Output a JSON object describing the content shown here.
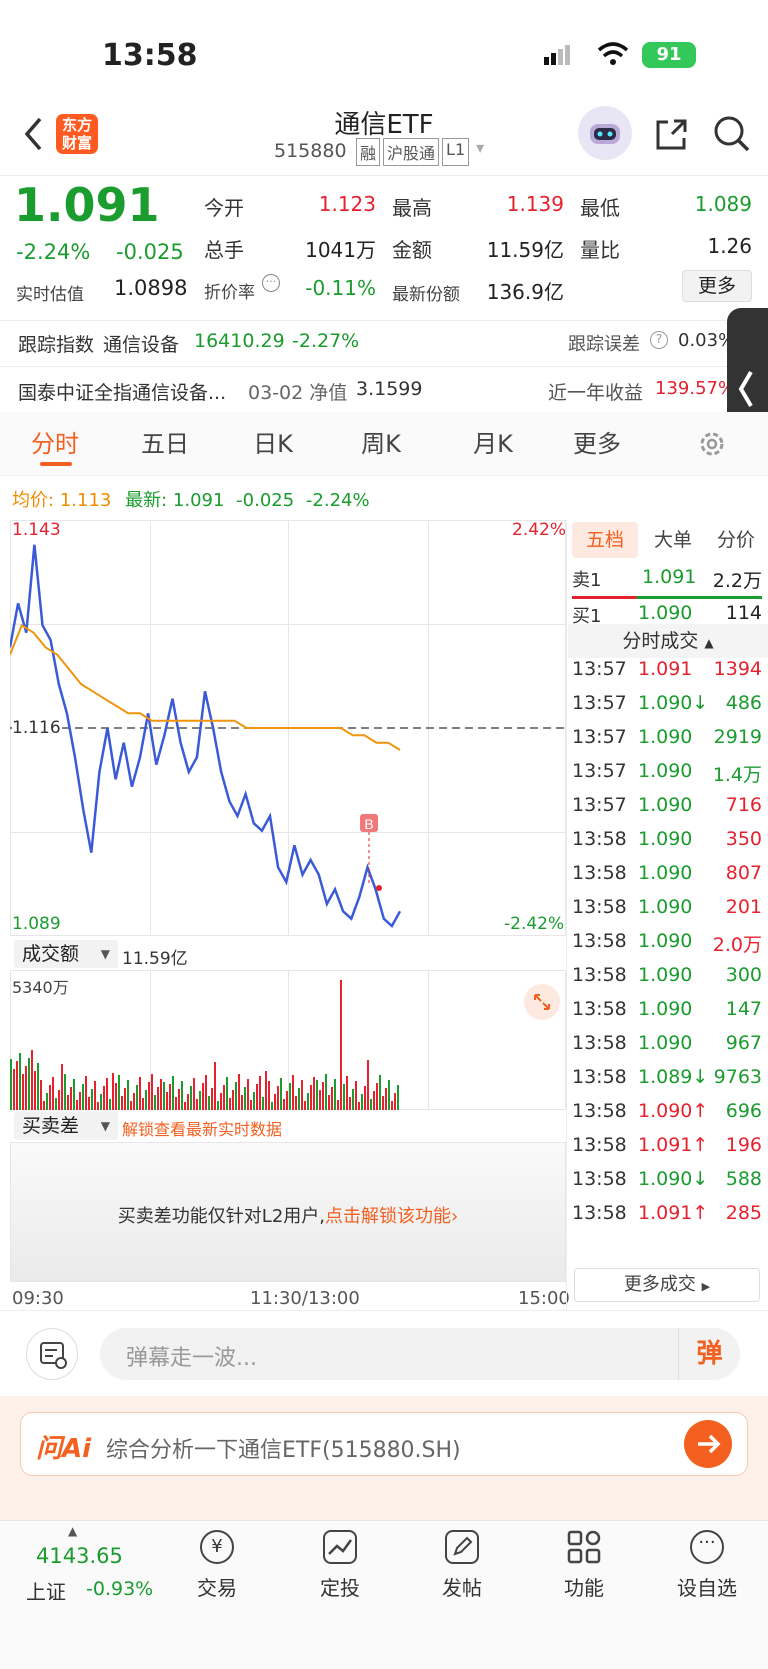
{
  "status": {
    "time": "13:58",
    "battery": "91"
  },
  "header": {
    "logo": "东方\n财富",
    "title": "通信ETF",
    "code": "515880",
    "tags": [
      "融",
      "沪股通",
      "L1"
    ]
  },
  "quote": {
    "price": "1.091",
    "change_pct": "-2.24%",
    "change": "-0.025",
    "est_label": "实时估值",
    "est": "1.0898",
    "open_label": "今开",
    "open": "1.123",
    "high_label": "最高",
    "high": "1.139",
    "low_label": "最低",
    "low": "1.089",
    "vol_label": "总手",
    "vol": "1041万",
    "amount_label": "金额",
    "amount": "11.59亿",
    "ratio_label": "量比",
    "ratio": "1.26",
    "disc_label": "折价率",
    "disc": "-0.11%",
    "shares_label": "最新份额",
    "shares": "136.9亿",
    "more": "更多"
  },
  "tracking": {
    "label": "跟踪指数",
    "index": "通信设备",
    "value": "16410.29",
    "pct": "-2.27%",
    "err_label": "跟踪误差",
    "err": "0.03%"
  },
  "fund": {
    "name": "国泰中证全指通信设备...",
    "date": "03-02 净值",
    "nav": "3.1599",
    "ret_label": "近一年收益",
    "ret": "139.57%"
  },
  "tabs": [
    "分时",
    "五日",
    "日K",
    "周K",
    "月K",
    "更多"
  ],
  "avgline": {
    "avg_label": "均价:",
    "avg": "1.113",
    "latest_label": "最新:",
    "latest": "1.091",
    "chg": "-0.025",
    "pct": "-2.24%"
  },
  "chart_data": {
    "type": "line",
    "ylim": [
      1.089,
      1.143
    ],
    "ref": "1.116",
    "y_top": "1.143",
    "y_bottom": "1.089",
    "pct_top": "2.42%",
    "pct_bottom": "-2.42%",
    "x_labels": [
      "09:30",
      "11:30/13:00",
      "15:00"
    ],
    "series": [
      {
        "values": [
          1.127,
          1.133,
          1.129,
          1.141,
          1.13,
          1.128,
          1.122,
          1.118,
          1.112,
          1.105,
          1.099,
          1.11,
          1.116,
          1.109,
          1.114,
          1.108,
          1.112,
          1.118,
          1.111,
          1.115,
          1.12,
          1.114,
          1.11,
          1.112,
          1.121,
          1.116,
          1.11,
          1.106,
          1.104,
          1.107,
          1.103,
          1.102,
          1.104,
          1.097,
          1.095,
          1.1,
          1.096,
          1.098,
          1.096,
          1.092,
          1.094,
          1.091,
          1.09,
          1.093,
          1.097,
          1.094,
          1.09,
          1.089,
          1.091
        ]
      },
      {
        "values": [
          1.126,
          1.13,
          1.129,
          1.127,
          1.126,
          1.124,
          1.122,
          1.121,
          1.12,
          1.119,
          1.118,
          1.118,
          1.117,
          1.117,
          1.117,
          1.117,
          1.117,
          1.117,
          1.117,
          1.117,
          1.116,
          1.116,
          1.116,
          1.116,
          1.116,
          1.116,
          1.116,
          1.116,
          1.116,
          1.115,
          1.115,
          1.114,
          1.114,
          1.113
        ]
      }
    ]
  },
  "vol": {
    "label": "成交额",
    "amount": "11.59亿",
    "max": "5340万"
  },
  "bsd": {
    "label": "买卖差",
    "unlock": "解锁查看最新实时数据",
    "notice": "买卖差功能仅针对L2用户,",
    "notice_link": "点击解锁该功能"
  },
  "book": {
    "tabs": [
      "五档",
      "大单",
      "分价"
    ],
    "sell_label": "卖1",
    "sell_price": "1.091",
    "sell_vol": "2.2万",
    "buy_label": "买1",
    "buy_price": "1.090",
    "buy_vol": "114",
    "ticks_label": "分时成交",
    "more": "更多成交"
  },
  "trades": [
    [
      "13:57",
      "1.091",
      "1394",
      "r"
    ],
    [
      "13:57",
      "1.090↓",
      "486",
      "g"
    ],
    [
      "13:57",
      "1.090",
      "2919",
      "g"
    ],
    [
      "13:57",
      "1.090",
      "1.4万",
      "g"
    ],
    [
      "13:57",
      "1.090",
      "716",
      "r"
    ],
    [
      "13:58",
      "1.090",
      "350",
      "r"
    ],
    [
      "13:58",
      "1.090",
      "807",
      "r"
    ],
    [
      "13:58",
      "1.090",
      "201",
      "r"
    ],
    [
      "13:58",
      "1.090",
      "2.0万",
      "r"
    ],
    [
      "13:58",
      "1.090",
      "300",
      "g"
    ],
    [
      "13:58",
      "1.090",
      "147",
      "g"
    ],
    [
      "13:58",
      "1.090",
      "967",
      "g"
    ],
    [
      "13:58",
      "1.089↓",
      "9763",
      "g"
    ],
    [
      "13:58",
      "1.090↑",
      "696",
      "g"
    ],
    [
      "13:58",
      "1.091↑",
      "196",
      "r"
    ],
    [
      "13:58",
      "1.090↓",
      "588",
      "g"
    ],
    [
      "13:58",
      "1.091↑",
      "285",
      "r"
    ]
  ],
  "danmu": {
    "placeholder": "弹幕走一波...",
    "btn": "弹"
  },
  "ai": {
    "logo": "问Ai",
    "text": "综合分析一下通信ETF(515880.SH)"
  },
  "nav": {
    "index_val": "4143.65",
    "index_name": "上证",
    "index_pct": "-0.93%",
    "items": [
      "交易",
      "定投",
      "发帖",
      "功能",
      "设自选"
    ]
  }
}
